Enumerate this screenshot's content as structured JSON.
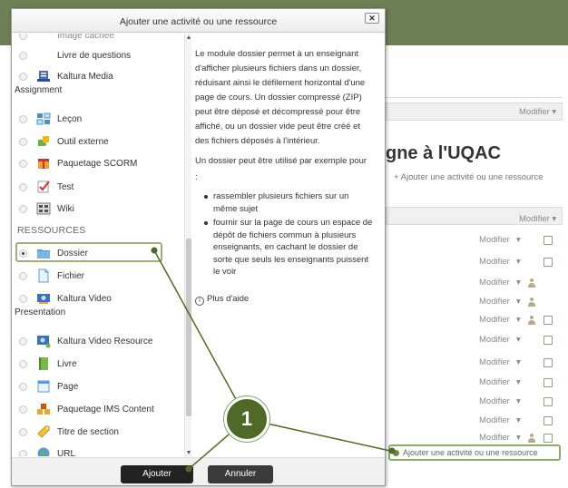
{
  "dialog": {
    "title": "Ajouter une activité ou une ressource",
    "close_label": "✕",
    "add_button": "Ajouter",
    "cancel_button": "Annuler"
  },
  "list": {
    "top_partial": "Image cachée",
    "activities": [
      {
        "label": "Livre de questions",
        "icon": "question-book-icon"
      },
      {
        "label": "Kaltura Media",
        "label2": "Assignment",
        "icon": "kaltura-media-icon"
      },
      {
        "label": "Leçon",
        "icon": "lesson-icon"
      },
      {
        "label": "Outil externe",
        "icon": "puzzle-icon"
      },
      {
        "label": "Paquetage SCORM",
        "icon": "scorm-icon"
      },
      {
        "label": "Test",
        "icon": "quiz-icon"
      },
      {
        "label": "Wiki",
        "icon": "wiki-icon"
      }
    ],
    "resources_heading": "RESSOURCES",
    "resources": [
      {
        "label": "Dossier",
        "icon": "folder-icon",
        "selected": true
      },
      {
        "label": "Fichier",
        "icon": "file-icon"
      },
      {
        "label": "Kaltura Video",
        "label2": "Presentation",
        "icon": "kaltura-video-icon"
      },
      {
        "label": "Kaltura Video Resource",
        "icon": "kaltura-resource-icon"
      },
      {
        "label": "Livre",
        "icon": "book-icon"
      },
      {
        "label": "Page",
        "icon": "page-icon"
      },
      {
        "label": "Paquetage IMS Content",
        "icon": "ims-icon"
      },
      {
        "label": "Titre de section",
        "icon": "label-icon"
      },
      {
        "label": "URL",
        "icon": "url-icon"
      }
    ]
  },
  "help": {
    "p1": "Le module dossier permet à un enseignant d'afficher plusieurs fichiers dans un dossier, réduisant ainsi le défilement horizontal d'une page de cours. Un dossier compressé (ZIP) peut être déposé et décompressé pour être affiché, ou un dossier vide peut être créé et des fichiers déposés à l'intérieur.",
    "p2": "Un dossier peut être utilisé par exemple pour",
    "colon": ":",
    "bullets": [
      "rassembler plusieurs fichiers sur un même sujet",
      "fournir sur la page de cours un espace de dépôt de fichiers commun à plusieurs enseignants, en cachant le dossier de sorte que seuls les enseignants puissent le voir"
    ],
    "more": "Plus d'aide"
  },
  "background": {
    "course_title": "gne à l'UQAC",
    "modifier": "Modifier",
    "add_activity": "+ Ajouter une activité ou une ressource",
    "add_activity_bottom": "Ajouter une activité ou une ressource"
  },
  "callout": {
    "number": "1"
  },
  "colors": {
    "header": "#6d7f54",
    "callout": "#4f6a28",
    "highlight": "#9cb07d"
  }
}
